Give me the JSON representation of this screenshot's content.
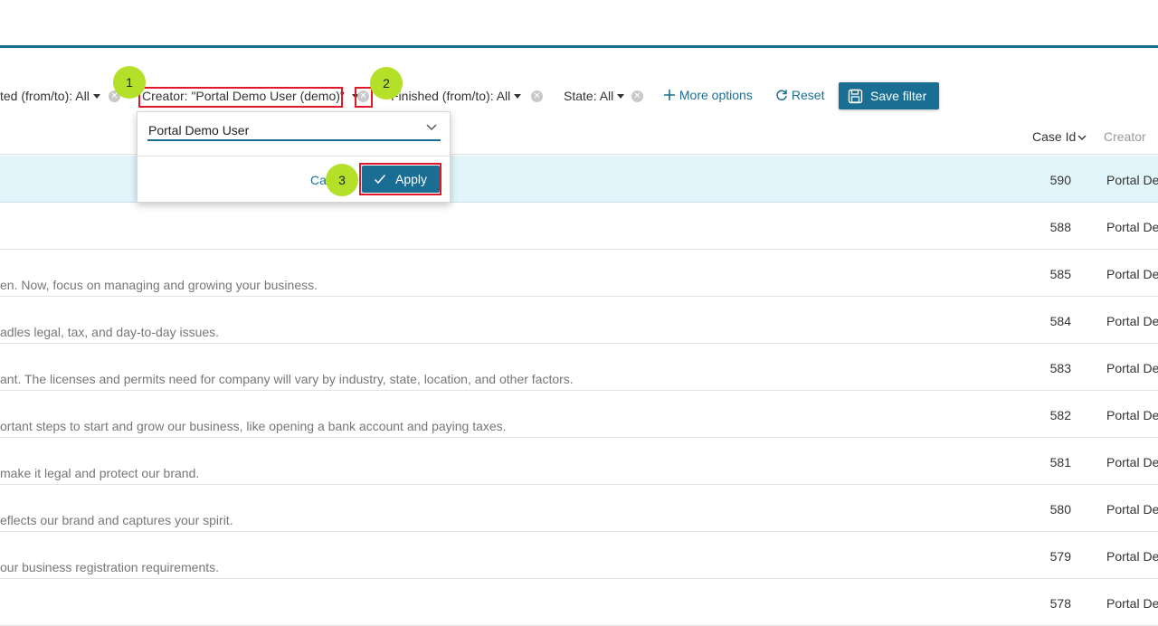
{
  "filters": {
    "created": "ted (from/to): All",
    "creator": "Creator: \"Portal Demo User (demo)\"",
    "finished": "Finished (from/to): All",
    "state": "State: All",
    "more_options": "More options",
    "reset": "Reset",
    "save_filter": "Save filter"
  },
  "badges": [
    "1",
    "2",
    "3"
  ],
  "popup": {
    "selected": "Portal Demo User",
    "cancel": "Cancel",
    "apply": "Apply"
  },
  "table": {
    "headers": {
      "case_id": "Case Id",
      "creator": "Creator"
    },
    "rows": [
      {
        "desc": "",
        "case_id": "590",
        "creator": "Portal Demo User",
        "selected": true
      },
      {
        "desc": "",
        "case_id": "588",
        "creator": "Portal Demo User"
      },
      {
        "desc": "en. Now, focus on managing and growing your business.",
        "case_id": "585",
        "creator": "Portal Demo User"
      },
      {
        "desc": "adles legal, tax, and day-to-day issues.",
        "case_id": "584",
        "creator": "Portal Demo User"
      },
      {
        "desc": "ant. The licenses and permits need for company will vary by industry, state, location, and other factors.",
        "case_id": "583",
        "creator": "Portal Demo User"
      },
      {
        "desc": "ortant steps to start and grow our business, like opening a bank account and paying taxes.",
        "case_id": "582",
        "creator": "Portal Demo User"
      },
      {
        "desc": "make it legal and protect our brand.",
        "case_id": "581",
        "creator": "Portal Demo User"
      },
      {
        "desc": "eflects our brand and captures your spirit.",
        "case_id": "580",
        "creator": "Portal Demo User"
      },
      {
        "desc": "our business registration requirements.",
        "case_id": "579",
        "creator": "Portal Demo User"
      },
      {
        "desc": "",
        "case_id": "578",
        "creator": "Portal Demo User"
      }
    ]
  },
  "colors": {
    "accent": "#1b6e93",
    "highlight": "#e0182a",
    "badge": "#b4e02a",
    "selected_row": "#e2f5fa"
  },
  "icons": [
    "close-circle-icon",
    "plus-icon",
    "refresh-icon",
    "save-icon",
    "chevron-down-icon",
    "check-icon",
    "caret-down-icon"
  ]
}
